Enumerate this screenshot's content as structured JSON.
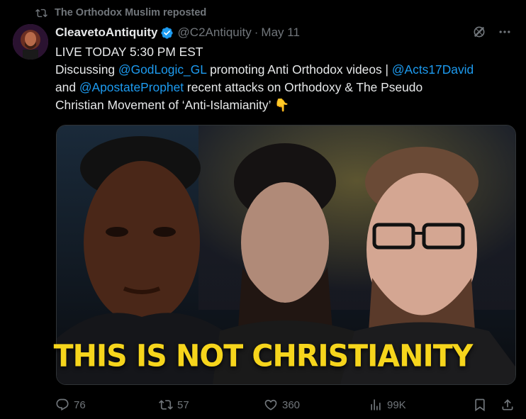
{
  "repost": {
    "label": "The Orthodox Muslim reposted"
  },
  "author": {
    "name": "CleavetoAntiquity",
    "handle": "@C2Antiquity",
    "separator": "·",
    "date": "May 11"
  },
  "tweet": {
    "line1": "LIVE TODAY 5:30 PM EST",
    "line2_pre": "Discussing ",
    "mention1": "@GodLogic_GL",
    "line2_mid": " promoting Anti Orthodox videos | ",
    "mention2": "@Acts17David",
    "line3_pre": "and ",
    "mention3": "@ApostateProphet",
    "line3_post": " recent attacks on Orthodoxy & The Pseudo",
    "line4": "Christian Movement of ‘Anti-Islamianity’",
    "emoji": "👇"
  },
  "media": {
    "banner": "THIS IS NOT CHRISTIANITY"
  },
  "actions": {
    "replies": "76",
    "reposts": "57",
    "likes": "360",
    "views": "99K"
  },
  "colors": {
    "accent": "#1d9bf0",
    "muted": "#71767b",
    "banner": "#f6d51c",
    "background": "#000000"
  }
}
